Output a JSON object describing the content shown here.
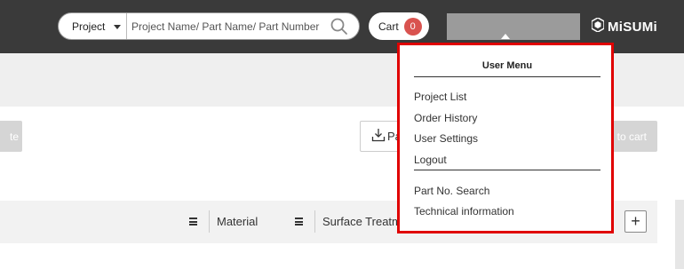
{
  "header": {
    "search": {
      "scope_label": "Project",
      "placeholder": "Project Name/ Part Name/ Part Number"
    },
    "cart": {
      "label": "Cart",
      "count": "0"
    },
    "logo_text": "MiSUMi"
  },
  "toolbar": {
    "left_button_label": "te",
    "download_button_label": "Pa",
    "add_to_cart_label": "to cart"
  },
  "table": {
    "columns": [
      "Material",
      "Surface Treatm"
    ],
    "add_column_label": "+"
  },
  "user_menu": {
    "title": "User Menu",
    "items": [
      "Project List",
      "Order History",
      "User Settings",
      "Logout"
    ],
    "secondary_items": [
      "Part No. Search",
      "Technical information"
    ]
  },
  "colors": {
    "header_bg": "#3a3a3a",
    "badge": "#d9534f",
    "menu_border": "#e00000"
  }
}
